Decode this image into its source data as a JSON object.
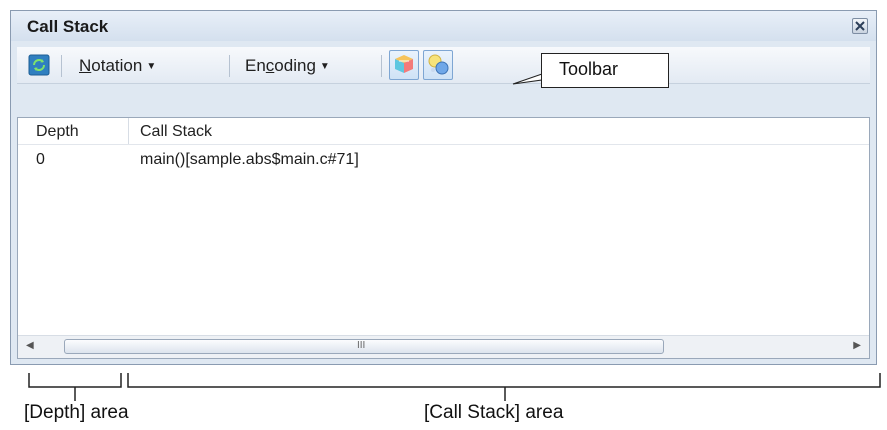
{
  "window": {
    "title": "Call Stack",
    "close_icon": "close-x-icon"
  },
  "toolbar": {
    "refresh_icon": "refresh-icon",
    "notation_label_pre": "",
    "notation_label_ul": "N",
    "notation_label_post": "otation",
    "encoding_label_pre": "En",
    "encoding_label_ul": "c",
    "encoding_label_post": "oding",
    "show_icon_1": "jump-to-source-icon",
    "show_icon_2": "jump-to-disassembly-icon"
  },
  "table": {
    "headers": [
      "Depth",
      "Call Stack"
    ],
    "rows": [
      {
        "depth": "0",
        "call_stack": "main()[sample.abs$main.c#71]"
      }
    ]
  },
  "scrollbar": {
    "grip": "III"
  },
  "annotations": {
    "toolbar_callout": "Toolbar",
    "depth_area": "[Depth] area",
    "callstack_area": "[Call Stack] area"
  },
  "colors": {
    "window_bg": "#dfe8f2",
    "border": "#8a9bb1",
    "pressed_bg": "#cfe2f6"
  }
}
